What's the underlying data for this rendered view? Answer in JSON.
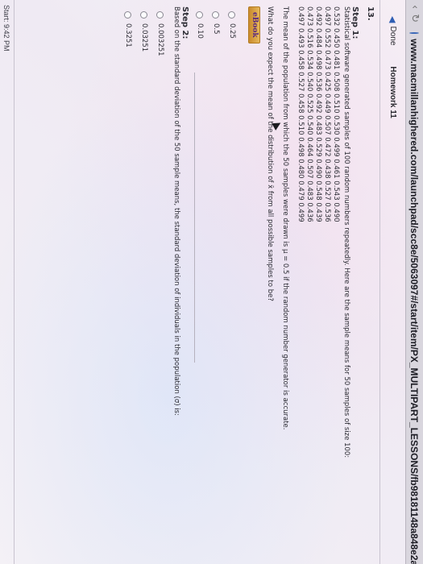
{
  "browser": {
    "url": "www.macmillanhighered.com/launchpad/scc8e/5063097#/start/item/PX_MULTIPART_LESSONS/fb98181148a848e2ac971"
  },
  "header": {
    "done_label": "Done",
    "title": "Homework 11"
  },
  "question": {
    "number": "13.",
    "step1_title": "Step 1:",
    "intro": "Statistical software generated samples of 100 random numbers repeatedly. Here are the sample means for 50 samples of size 100:",
    "means_rows": [
      "0.532 0.450 0.481 0.508 0.510 0.530 0.499 0.461 0.543 0.490",
      "0.497 0.552 0.473 0.425 0.449 0.507 0.472 0.438 0.527 0.536",
      "0.492 0.484 0.498 0.536 0.492 0.483 0.529 0.490 0.548 0.439",
      "0.473 0.516 0.534 0.540 0.525 0.540 0.464 0.507 0.483 0.436",
      "0.497 0.493 0.458 0.527 0.458 0.510 0.498 0.480 0.479 0.499"
    ],
    "population_note": "The mean of the population from which the 50 samples were drawn is μ = 0.5 if the random number generator is accurate.",
    "prompt": "What do you expect the mean of the distribution of x̄ from all possible samples to be?",
    "ebook_label": "eBook",
    "options": [
      "0.25",
      "0.5",
      "0.10"
    ]
  },
  "step2": {
    "title": "Step 2:",
    "prompt": "Based on the standard deviation of the 50 sample means, the standard deviation of individuals in the population (σ) is:",
    "options": [
      "0.003251",
      "0.03251",
      "0.3251"
    ]
  },
  "footer": {
    "start_label": "Start: 9:42 PM"
  }
}
